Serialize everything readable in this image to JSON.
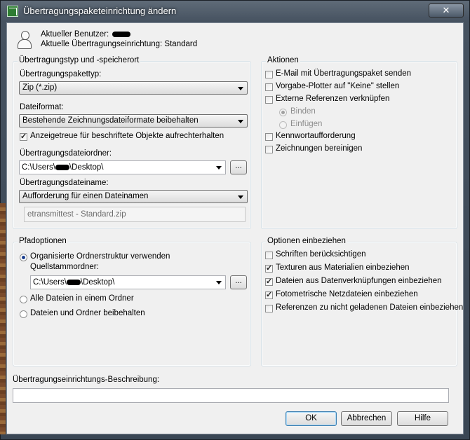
{
  "window": {
    "title": "Übertragungspaketeinrichtung ändern",
    "close_label": "✕"
  },
  "header": {
    "current_user_label": "Aktueller Benutzer:",
    "current_setup_label": "Aktuelle Übertragungseinrichtung: Standard"
  },
  "type_location": {
    "group_label": "Übertragungstyp und -speicherort",
    "package_type_label": "Übertragungspakettyp:",
    "package_type_value": "Zip (*.zip)",
    "file_format_label": "Dateiformat:",
    "file_format_value": "Bestehende Zeichnungsdateiformate beibehalten",
    "annotative_label": "Anzeigetreue für beschriftete Objekte aufrechterhalten",
    "annotative_checked": true,
    "folder_label": "Übertragungsdateiordner:",
    "folder_prefix": "C:\\Users\\",
    "folder_suffix": "\\Desktop\\",
    "browse_label": "...",
    "filename_label": "Übertragungsdateiname:",
    "filename_value": "Aufforderung für einen Dateinamen",
    "filename_preview": "etransmittest - Standard.zip"
  },
  "actions": {
    "group_label": "Aktionen",
    "email": "E-Mail mit Übertragungspaket senden",
    "plotter": "Vorgabe-Plotter auf \"Keine\" stellen",
    "bind_xrefs": "Externe Referenzen verknüpfen",
    "bind": "Binden",
    "insert": "Einfügen",
    "password": "Kennwortaufforderung",
    "purge": "Zeichnungen bereinigen"
  },
  "path_options": {
    "group_label": "Pfadoptionen",
    "organized": "Organisierte Ordnerstruktur verwenden",
    "source_root_label": "Quellstammordner:",
    "source_prefix": "C:\\Users\\",
    "source_suffix": "\\Desktop\\",
    "browse_label": "...",
    "single_folder": "Alle Dateien in einem Ordner",
    "keep_files": "Dateien und Ordner beibehalten"
  },
  "include_options": {
    "group_label": "Optionen einbeziehen",
    "fonts": "Schriften berücksichtigen",
    "textures": "Texturen aus Materialien einbeziehen",
    "data_links": "Dateien aus Datenverknüpfungen einbeziehen",
    "photometric": "Fotometrische Netzdateien einbeziehen",
    "unloaded_refs": "Referenzen zu nicht geladenen Dateien einbeziehen"
  },
  "description": {
    "label": "Übertragungseinrichtungs-Beschreibung:",
    "value": ""
  },
  "buttons": {
    "ok": "OK",
    "cancel": "Abbrechen",
    "help": "Hilfe"
  }
}
